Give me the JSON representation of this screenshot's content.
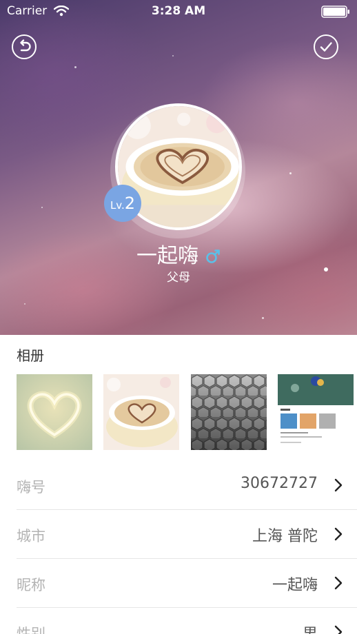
{
  "status_bar": {
    "carrier": "Carrier",
    "time": "3:28 AM"
  },
  "header": {
    "back_icon": "back-undo-icon",
    "confirm_icon": "checkmark-icon",
    "level_prefix": "Lv.",
    "level_number": "2",
    "nickname": "一起嗨",
    "gender_icon": "male-symbol-icon",
    "role": "父母"
  },
  "album": {
    "title": "相册"
  },
  "info_rows": [
    {
      "label": "嗨号",
      "value": "30672727"
    },
    {
      "label": "城市",
      "value": "上海 普陀"
    },
    {
      "label": "昵称",
      "value": "一起嗨"
    },
    {
      "label": "性别",
      "value": "男"
    }
  ],
  "colors": {
    "level_badge": "#7aa5e3",
    "gender_icon": "#5bc0e8",
    "divider": "#e6e6e6",
    "label_text": "#b3b3b3"
  }
}
